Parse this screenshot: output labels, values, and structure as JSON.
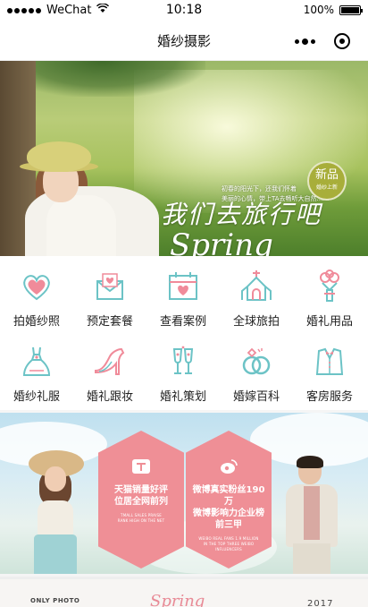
{
  "status_bar": {
    "carrier": "WeChat",
    "time": "10:18",
    "battery": "100%"
  },
  "nav": {
    "title": "婚纱摄影"
  },
  "banner": {
    "headline": "我们去旅行吧",
    "script": "Spring",
    "small_line1": "初春的阳光下，还我们怀着",
    "small_line2": "美丽的心情，带上TA去畅听大自然……",
    "badge_main": "新品",
    "badge_sub": "婚纱上新"
  },
  "grid": {
    "items": [
      {
        "label": "拍婚纱照",
        "icon": "heart-frame-icon"
      },
      {
        "label": "预定套餐",
        "icon": "envelope-heart-icon"
      },
      {
        "label": "查看案例",
        "icon": "calendar-heart-icon"
      },
      {
        "label": "全球旅拍",
        "icon": "chapel-icon"
      },
      {
        "label": "婚礼用品",
        "icon": "bouquet-icon"
      },
      {
        "label": "婚纱礼服",
        "icon": "wedding-dress-icon"
      },
      {
        "label": "婚礼跟妆",
        "icon": "high-heel-icon"
      },
      {
        "label": "婚礼策划",
        "icon": "champagne-icon"
      },
      {
        "label": "婚嫁百科",
        "icon": "rings-icon"
      },
      {
        "label": "客房服务",
        "icon": "tuxedo-icon"
      }
    ]
  },
  "promo": {
    "hex1": {
      "title_line1": "天猫销量好评",
      "title_line2": "位居全网前列",
      "sub_line1": "TMALL SALES PRAISE",
      "sub_line2": "RANK HIGH ON THE NET",
      "icon": "tmall-icon"
    },
    "hex2": {
      "title_line1": "微博真实粉丝190万",
      "title_line2": "微博影响力企业榜",
      "title_line3": "前三甲",
      "sub_line1": "WEIBO REAL FANS 1.9 MILLION",
      "sub_line2": "IN THE TOP THREE WEIBO INFLUENCERS",
      "icon": "weibo-icon"
    }
  },
  "bottom_peek": {
    "left_label": "ONLY PHOTO",
    "script": "Spring",
    "year": "2017"
  },
  "colors": {
    "accent": "#ef8f96",
    "icon_teal": "#6cc3c6",
    "icon_pink": "#f08b9a"
  }
}
